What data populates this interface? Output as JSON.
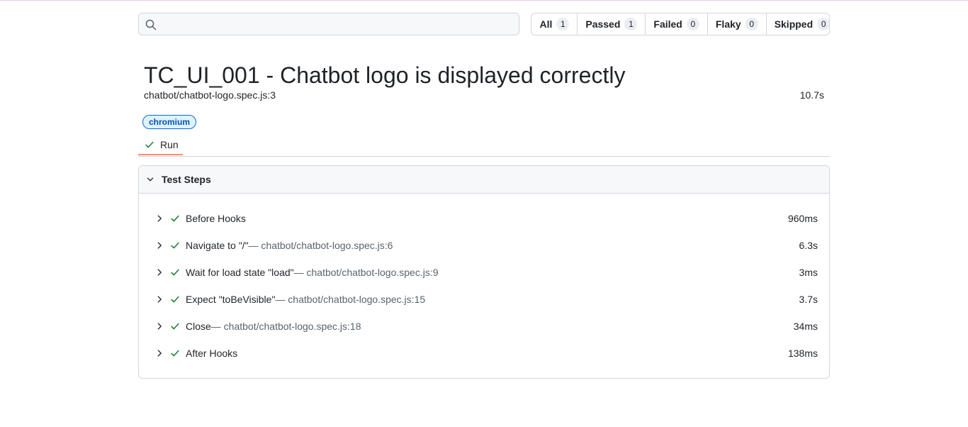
{
  "search": {
    "value": "",
    "placeholder": ""
  },
  "filters": [
    {
      "label": "All",
      "count": "1"
    },
    {
      "label": "Passed",
      "count": "1"
    },
    {
      "label": "Failed",
      "count": "0"
    },
    {
      "label": "Flaky",
      "count": "0"
    },
    {
      "label": "Skipped",
      "count": "0"
    }
  ],
  "test": {
    "title": "TC_UI_001 - Chatbot logo is displayed correctly",
    "location": "chatbot/chatbot-logo.spec.js:3",
    "duration": "10.7s",
    "label": "chromium"
  },
  "tabs": [
    {
      "label": "Run",
      "status_icon": "check-icon"
    }
  ],
  "steps_panel": {
    "title": "Test Steps",
    "steps": [
      {
        "title": "Before Hooks",
        "location": "",
        "duration": "960ms"
      },
      {
        "title": "Navigate to \"/\"",
        "location": " — chatbot/chatbot-logo.spec.js:6",
        "duration": "6.3s"
      },
      {
        "title": "Wait for load state \"load\"",
        "location": " — chatbot/chatbot-logo.spec.js:9",
        "duration": "3ms"
      },
      {
        "title": "Expect \"toBeVisible\"",
        "location": " — chatbot/chatbot-logo.spec.js:15",
        "duration": "3.7s"
      },
      {
        "title": "Close",
        "location": " — chatbot/chatbot-logo.spec.js:18",
        "duration": "34ms"
      },
      {
        "title": "After Hooks",
        "location": "",
        "duration": "138ms"
      }
    ]
  },
  "colors": {
    "success": "#1a7f37",
    "tab_underline": "#fd8c73",
    "chip_border": "#0969da",
    "chip_bg": "#ddf4ff"
  }
}
